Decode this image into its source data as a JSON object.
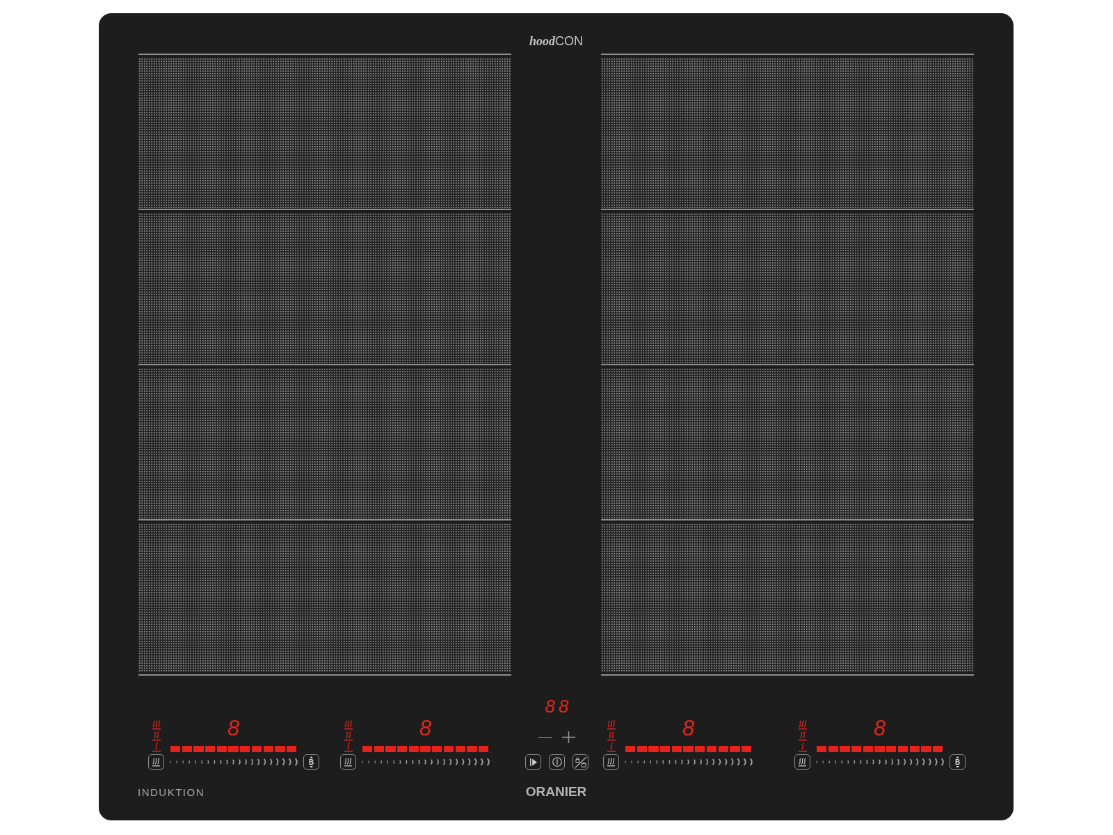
{
  "logo": "**hood**CON",
  "zone_controls": [
    {
      "display": "8",
      "level": 1,
      "bridge_button": "B"
    },
    {
      "display": "8",
      "level": 1
    },
    {
      "display": "8",
      "level": 1
    },
    {
      "display": "8",
      "level": 1,
      "bridge_button": "B"
    }
  ],
  "center_controls": {
    "timer_display": "88"
  },
  "footer": {
    "label": "INDUKTION",
    "brand": "ORANIER"
  }
}
